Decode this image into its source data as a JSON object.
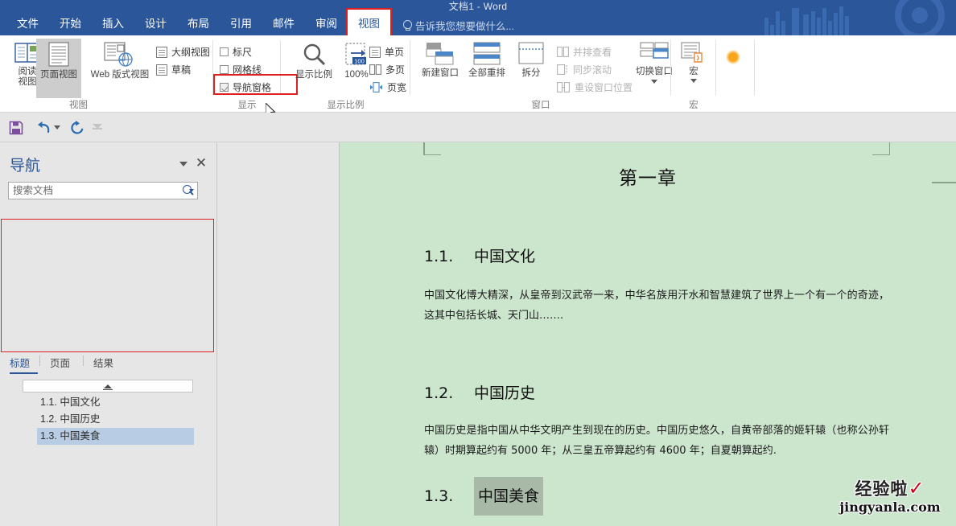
{
  "window": {
    "title": "文档1 - Word"
  },
  "ribbon_tabs": [
    {
      "label": "文件",
      "active": false
    },
    {
      "label": "开始",
      "active": false
    },
    {
      "label": "插入",
      "active": false
    },
    {
      "label": "设计",
      "active": false
    },
    {
      "label": "布局",
      "active": false
    },
    {
      "label": "引用",
      "active": false
    },
    {
      "label": "邮件",
      "active": false
    },
    {
      "label": "审阅",
      "active": false
    },
    {
      "label": "视图",
      "active": true
    }
  ],
  "tell_me": "告诉我您想要做什么...",
  "ribbon": {
    "groups": {
      "views": {
        "label": "视图",
        "buttons": [
          {
            "label": "阅读\n视图",
            "icon": "read-view-icon",
            "selected": false
          },
          {
            "label": "页面视图",
            "icon": "print-layout-icon",
            "selected": true
          },
          {
            "label": "Web 版式视图",
            "icon": "web-layout-icon",
            "selected": false
          }
        ],
        "small_items": [
          {
            "label": "大纲视图",
            "icon": "outline-view-icon"
          },
          {
            "label": "草稿",
            "icon": "draft-view-icon"
          }
        ]
      },
      "show": {
        "label": "显示",
        "checkboxes": [
          {
            "label": "标尺",
            "checked": false
          },
          {
            "label": "网格线",
            "checked": false
          },
          {
            "label": "导航窗格",
            "checked": true,
            "annotated": true
          }
        ]
      },
      "zoom": {
        "label": "显示比例",
        "buttons": [
          {
            "label": "显示比例",
            "icon": "magnifier-icon"
          },
          {
            "label": "100%",
            "icon": "zoom-100-icon"
          }
        ],
        "small_items": [
          {
            "label": "单页",
            "icon": "one-page-icon"
          },
          {
            "label": "多页",
            "icon": "multi-page-icon"
          },
          {
            "label": "页宽",
            "icon": "page-width-icon"
          }
        ]
      },
      "window": {
        "label": "窗口",
        "buttons": [
          {
            "label": "新建窗口",
            "icon": "new-window-icon"
          },
          {
            "label": "全部重排",
            "icon": "arrange-all-icon"
          },
          {
            "label": "拆分",
            "icon": "split-icon"
          },
          {
            "label": "切换窗口",
            "icon": "switch-windows-icon",
            "has_dropdown": true
          }
        ],
        "small_items": [
          {
            "label": "并排查看",
            "icon": "view-side-by-side-icon",
            "disabled": true
          },
          {
            "label": "同步滚动",
            "icon": "synchronous-scrolling-icon",
            "disabled": true
          },
          {
            "label": "重设窗口位置",
            "icon": "reset-window-position-icon",
            "disabled": true
          }
        ]
      },
      "macros": {
        "label": "宏",
        "buttons": [
          {
            "label": "宏",
            "icon": "macros-icon",
            "has_dropdown": true
          }
        ]
      }
    }
  },
  "quick_access": {
    "items": [
      {
        "name": "save-icon",
        "label": "保存"
      },
      {
        "name": "undo-icon",
        "label": "撤消",
        "has_dropdown": true
      },
      {
        "name": "redo-icon",
        "label": "重复"
      },
      {
        "name": "customize-qat-icon",
        "label": "自定义快速访问工具栏"
      }
    ]
  },
  "navigation_pane": {
    "title": "导航",
    "search": {
      "placeholder": "搜索文档",
      "value": ""
    },
    "tabs": [
      {
        "label": "标题",
        "active": true
      },
      {
        "label": "页面",
        "active": false
      },
      {
        "label": "结果",
        "active": false
      }
    ],
    "headings": [
      {
        "label": "1.1. 中国文化",
        "selected": false
      },
      {
        "label": "1.2. 中国历史",
        "selected": false
      },
      {
        "label": "1.3. 中国美食",
        "selected": true
      }
    ]
  },
  "document": {
    "title": "第一章",
    "sections": [
      {
        "number": "1.1.",
        "heading": "中国文化",
        "body": "中国文化博大精深，从皇帝到汉武帝一来，中华名族用汗水和智慧建筑了世界上一个有一个的奇迹，这其中包括长城、天门山…….",
        "selected": false
      },
      {
        "number": "1.2.",
        "heading": "中国历史",
        "body": "中国历史是指中国从中华文明产生到现在的历史。中国历史悠久，自黄帝部落的姬轩辕（也称公孙轩辕）时期算起约有 5000 年；从三皇五帝算起约有 4600 年；自夏朝算起约.",
        "selected": false
      },
      {
        "number": "1.3.",
        "heading": "中国美食",
        "body": "",
        "selected": true
      }
    ]
  },
  "watermark": {
    "line1": "经验啦",
    "check": "✓",
    "line2": "jingyanla.com"
  },
  "colors": {
    "titlebar": "#2b579a",
    "accent": "#2b579a",
    "annotation": "#e02020",
    "page_background": "#cce5cd",
    "selection": "#b8cce4",
    "text_selection": "#a8b9a8"
  }
}
